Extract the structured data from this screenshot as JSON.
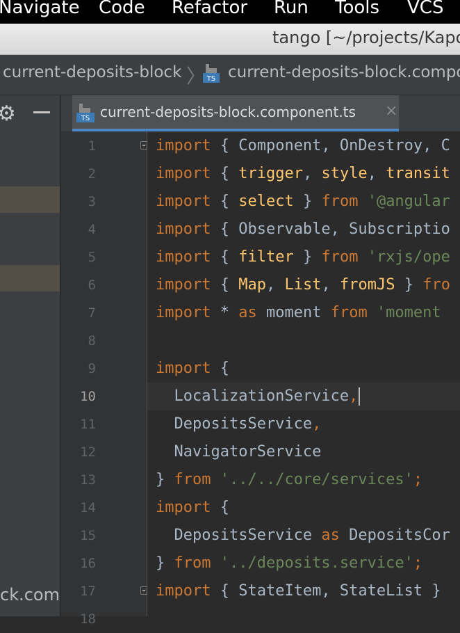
{
  "menu": [
    "Navigate",
    "Code",
    "Refactor",
    "Run",
    "Tools",
    "VCS"
  ],
  "window_title": "tango [~/projects/Kapo",
  "breadcrumbs": {
    "folder": "current-deposits-block",
    "file": "current-deposits-block.compo"
  },
  "file_icon_label": "TS",
  "project_panel": {
    "partial_filename": "ck.comp"
  },
  "tab": {
    "label": "current-deposits-block.component.ts",
    "close": "×"
  },
  "editor": {
    "current_line": 10,
    "lines": [
      {
        "n": "1",
        "tokens": [
          {
            "c": "k",
            "t": "import"
          },
          {
            "c": "t",
            "t": " { Component, OnDestroy, C"
          }
        ]
      },
      {
        "n": "2",
        "tokens": [
          {
            "c": "k",
            "t": "import"
          },
          {
            "c": "t",
            "t": " { "
          },
          {
            "c": "f",
            "t": "trigger"
          },
          {
            "c": "t",
            "t": ", "
          },
          {
            "c": "f",
            "t": "style"
          },
          {
            "c": "t",
            "t": ", "
          },
          {
            "c": "f",
            "t": "transit"
          }
        ]
      },
      {
        "n": "3",
        "tokens": [
          {
            "c": "k",
            "t": "import"
          },
          {
            "c": "t",
            "t": " { "
          },
          {
            "c": "f",
            "t": "select"
          },
          {
            "c": "t",
            "t": " } "
          },
          {
            "c": "k",
            "t": "from"
          },
          {
            "c": "s",
            "t": " '@angular"
          }
        ]
      },
      {
        "n": "4",
        "tokens": [
          {
            "c": "k",
            "t": "import"
          },
          {
            "c": "t",
            "t": " { Observable, Subscriptio"
          }
        ]
      },
      {
        "n": "5",
        "tokens": [
          {
            "c": "k",
            "t": "import"
          },
          {
            "c": "t",
            "t": " { "
          },
          {
            "c": "f",
            "t": "filter"
          },
          {
            "c": "t",
            "t": " } "
          },
          {
            "c": "k",
            "t": "from"
          },
          {
            "c": "s",
            "t": " 'rxjs/ope"
          }
        ]
      },
      {
        "n": "6",
        "tokens": [
          {
            "c": "k",
            "t": "import"
          },
          {
            "c": "t",
            "t": " { "
          },
          {
            "c": "f",
            "t": "Map"
          },
          {
            "c": "t",
            "t": ", "
          },
          {
            "c": "f",
            "t": "List"
          },
          {
            "c": "t",
            "t": ", "
          },
          {
            "c": "f",
            "t": "fromJS"
          },
          {
            "c": "t",
            "t": " } "
          },
          {
            "c": "k",
            "t": "fro"
          }
        ]
      },
      {
        "n": "7",
        "tokens": [
          {
            "c": "k",
            "t": "import"
          },
          {
            "c": "t",
            "t": " * "
          },
          {
            "c": "k",
            "t": "as"
          },
          {
            "c": "t",
            "t": " moment "
          },
          {
            "c": "k",
            "t": "from"
          },
          {
            "c": "s",
            "t": " 'moment"
          }
        ]
      },
      {
        "n": "8",
        "tokens": []
      },
      {
        "n": "9",
        "tokens": [
          {
            "c": "k",
            "t": "import"
          },
          {
            "c": "t",
            "t": " {"
          }
        ]
      },
      {
        "n": "10",
        "tokens": [
          {
            "c": "t",
            "t": "  LocalizationService"
          },
          {
            "c": "k",
            "t": ","
          }
        ]
      },
      {
        "n": "11",
        "tokens": [
          {
            "c": "t",
            "t": "  DepositsService"
          },
          {
            "c": "k",
            "t": ","
          }
        ]
      },
      {
        "n": "12",
        "tokens": [
          {
            "c": "t",
            "t": "  NavigatorService"
          }
        ]
      },
      {
        "n": "13",
        "tokens": [
          {
            "c": "t",
            "t": "} "
          },
          {
            "c": "k",
            "t": "from"
          },
          {
            "c": "s",
            "t": " '../../core/services'"
          },
          {
            "c": "k",
            "t": ";"
          }
        ]
      },
      {
        "n": "14",
        "tokens": [
          {
            "c": "k",
            "t": "import"
          },
          {
            "c": "t",
            "t": " {"
          }
        ]
      },
      {
        "n": "15",
        "tokens": [
          {
            "c": "t",
            "t": "  DepositsService "
          },
          {
            "c": "k",
            "t": "as"
          },
          {
            "c": "t",
            "t": " DepositsCor"
          }
        ]
      },
      {
        "n": "16",
        "tokens": [
          {
            "c": "t",
            "t": "} "
          },
          {
            "c": "k",
            "t": "from"
          },
          {
            "c": "s",
            "t": " '../deposits.service'"
          },
          {
            "c": "k",
            "t": ";"
          }
        ]
      },
      {
        "n": "17",
        "tokens": [
          {
            "c": "k",
            "t": "import"
          },
          {
            "c": "t",
            "t": " { StateItem, StateList }"
          }
        ]
      },
      {
        "n": "18",
        "tokens": []
      }
    ]
  }
}
